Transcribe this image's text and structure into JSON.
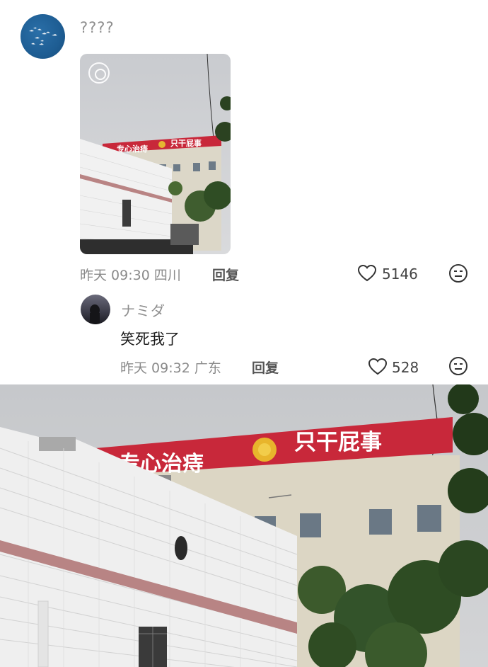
{
  "post": {
    "username": "????",
    "meta": "昨天 09:30 四川",
    "reply_label": "回复",
    "like_count": "5146",
    "photo_banner_left": "专心治痔",
    "photo_banner_right": "只干屁事"
  },
  "reply": {
    "username": "ナミダ",
    "text": "笑死我了",
    "meta": "昨天 09:32 广东",
    "reply_label": "回复",
    "like_count": "528"
  },
  "big_photo": {
    "banner_left": "专心治痔",
    "banner_right": "只干屁事"
  },
  "colors": {
    "banner_red": "#c8283a",
    "avatar_blue": "#1e5d93"
  },
  "icons": {
    "like": "heart-outline-icon",
    "emoji": "neutral-face-icon",
    "live": "live-photo-icon"
  }
}
